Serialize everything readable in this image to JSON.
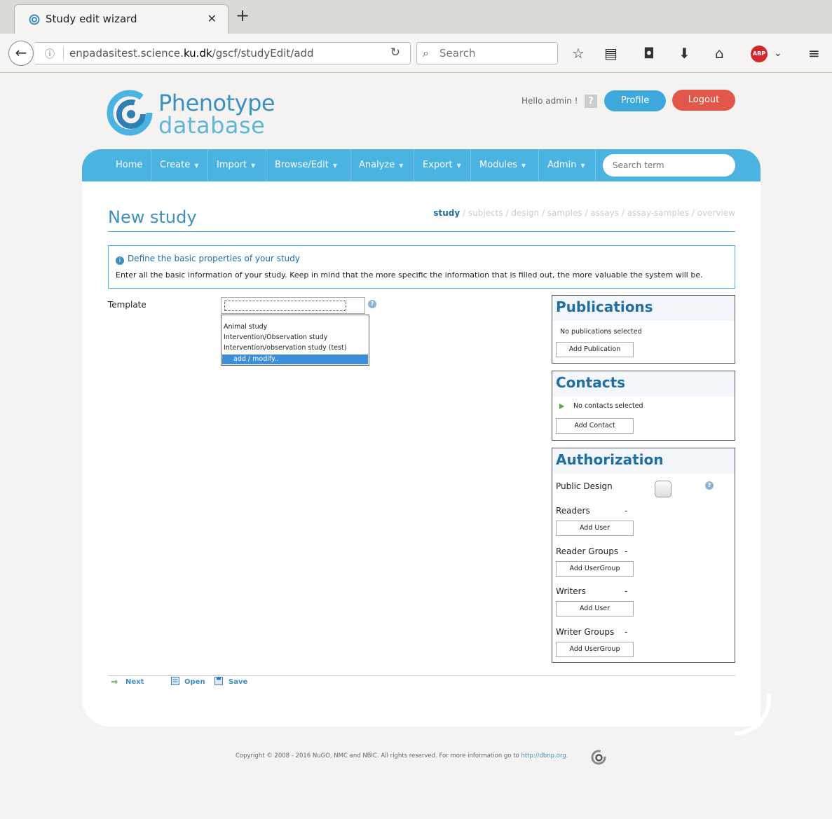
{
  "browser": {
    "tab_title": "Study edit wizard",
    "url_prefix": "enpadasitest.science.",
    "url_domain": "ku.dk",
    "url_path": "/gscf/studyEdit/add",
    "search_placeholder": "Search",
    "abp_label": "ABP"
  },
  "header": {
    "logo_line1": "Phenotype",
    "logo_line2": "database",
    "greeting": "Hello admin !",
    "help_label": "?",
    "profile_label": "Profile",
    "logout_label": "Logout"
  },
  "menu": {
    "items": [
      {
        "label": "Home",
        "has_caret": false
      },
      {
        "label": "Create",
        "has_caret": true
      },
      {
        "label": "Import",
        "has_caret": true
      },
      {
        "label": "Browse/Edit",
        "has_caret": true
      },
      {
        "label": "Analyze",
        "has_caret": true
      },
      {
        "label": "Export",
        "has_caret": true
      },
      {
        "label": "Modules",
        "has_caret": true
      },
      {
        "label": "Admin",
        "has_caret": true
      }
    ],
    "search_placeholder": "Search term"
  },
  "page": {
    "title": "New study",
    "steps": [
      "study",
      "subjects",
      "design",
      "samples",
      "assays",
      "assay-samples",
      "overview"
    ],
    "active_step": "study",
    "info_title": "Define the basic properties of your study",
    "info_text": "Enter all the basic information of your study. Keep in mind that the more specific the information that is filled out, the more valuable the system will be."
  },
  "template": {
    "label": "Template",
    "options": [
      "Animal study",
      "Intervention/Observation study",
      "Intervention/observation study (test)"
    ],
    "highlighted_option": "add / modify.."
  },
  "publications": {
    "title": "Publications",
    "empty_text": "No publications selected",
    "add_label": "Add Publication"
  },
  "contacts": {
    "title": "Contacts",
    "empty_text": "No contacts selected",
    "add_label": "Add Contact"
  },
  "authorization": {
    "title": "Authorization",
    "public_design_label": "Public Design",
    "rows": [
      {
        "label": "Readers",
        "value": "-",
        "button": "Add User"
      },
      {
        "label": "Reader Groups",
        "value": "-",
        "button": "Add UserGroup"
      },
      {
        "label": "Writers",
        "value": "-",
        "button": "Add User"
      },
      {
        "label": "Writer Groups",
        "value": "-",
        "button": "Add UserGroup"
      }
    ]
  },
  "footer_actions": {
    "next_label": "Next",
    "open_label": "Open",
    "save_label": "Save"
  },
  "copyright": {
    "text": "Copyright © 2008 - 2016 NuGO, NMC and NBIC. All rights reserved. For more information go to ",
    "link_text": "http://dbnp.org."
  },
  "colors": {
    "accent": "#4ab3e2",
    "title_blue": "#3d8fbf",
    "profile": "#3ea9dd",
    "logout": "#e1574a",
    "selected_option": "#3c8ed6"
  }
}
